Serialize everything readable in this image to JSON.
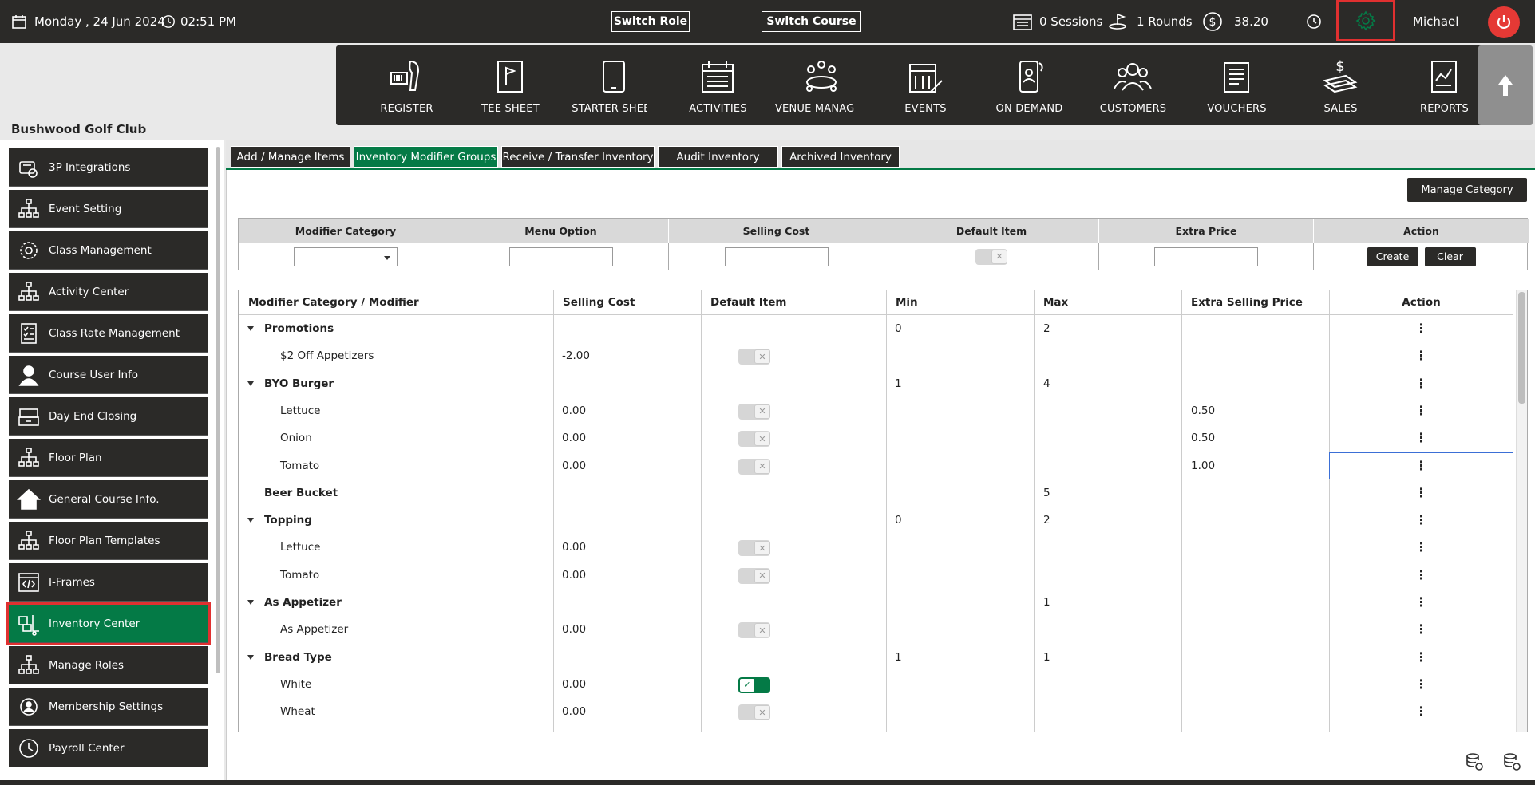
{
  "topbar": {
    "date": "Monday ,  24 Jun 2024",
    "time": "02:51 PM",
    "switch_role": "Switch Role",
    "switch_course": "Switch Course",
    "sessions": "0 Sessions",
    "rounds": "1 Rounds",
    "balance": "38.20",
    "user": "Michael",
    "gear_color": "#047a46",
    "power_color": "#e53935"
  },
  "modules": [
    {
      "label": "REGISTER",
      "icon": "barcode-scanner-icon"
    },
    {
      "label": "TEE SHEET",
      "icon": "golf-flag-icon"
    },
    {
      "label": "STARTER SHEET",
      "icon": "tablet-icon"
    },
    {
      "label": "ACTIVITIES",
      "icon": "calendar-list-icon"
    },
    {
      "label": "VENUE MANAGER",
      "icon": "meeting-table-icon"
    },
    {
      "label": "EVENTS",
      "icon": "calendar-edit-icon"
    },
    {
      "label": "ON DEMAND",
      "icon": "mobile-person-icon"
    },
    {
      "label": "CUSTOMERS",
      "icon": "people-group-icon"
    },
    {
      "label": "VOUCHERS",
      "icon": "voucher-icon"
    },
    {
      "label": "SALES",
      "icon": "sales-money-icon"
    },
    {
      "label": "REPORTS",
      "icon": "report-chart-icon"
    }
  ],
  "club_name": "Bushwood Golf Club",
  "sidebar": {
    "items": [
      {
        "label": "3P Integrations",
        "icon": "integrations-icon"
      },
      {
        "label": "Event Setting",
        "icon": "org-chart-icon"
      },
      {
        "label": "Class Management",
        "icon": "class-gear-icon"
      },
      {
        "label": "Activity  Center",
        "icon": "org-chart-icon"
      },
      {
        "label": "Class Rate Management",
        "icon": "checklist-icon"
      },
      {
        "label": "Course User Info",
        "icon": "user-icon"
      },
      {
        "label": "Day End Closing",
        "icon": "register-drawer-icon"
      },
      {
        "label": "Floor Plan",
        "icon": "org-chart-icon"
      },
      {
        "label": "General Course Info.",
        "icon": "home-icon"
      },
      {
        "label": "Floor Plan Templates",
        "icon": "org-chart-icon"
      },
      {
        "label": "I-Frames",
        "icon": "code-frame-icon"
      },
      {
        "label": "Inventory Center",
        "icon": "inventory-dolly-icon"
      },
      {
        "label": "Manage Roles",
        "icon": "org-chart-icon"
      },
      {
        "label": "Membership Settings",
        "icon": "gear-person-icon"
      },
      {
        "label": "Payroll Center",
        "icon": "clock-icon"
      }
    ],
    "active": "Inventory Center"
  },
  "tabs": [
    "Add / Manage Items",
    "Inventory Modifier Groups",
    "Receive / Transfer Inventory",
    "Audit Inventory",
    "Archived Inventory"
  ],
  "active_tab": "Inventory Modifier Groups",
  "manage_category": "Manage Category",
  "filter": {
    "headers": [
      "Modifier Category",
      "Menu Option",
      "Selling Cost",
      "Default Item",
      "Extra Price",
      "Action"
    ],
    "modifier_category_value": "",
    "menu_option_value": "",
    "selling_cost_value": "",
    "extra_price_value": "",
    "default_item_on": false,
    "create": "Create",
    "clear": "Clear"
  },
  "grid": {
    "headers": [
      "Modifier Category / Modifier",
      "Selling Cost",
      "Default Item",
      "Min",
      "Max",
      "Extra Selling Price",
      "Action"
    ],
    "rows": [
      {
        "name": "Promotions",
        "group": true,
        "cost": "",
        "toggle": null,
        "min": "0",
        "max": "2",
        "extra": ""
      },
      {
        "name": "$2 Off Appetizers",
        "group": false,
        "cost": "-2.00",
        "toggle": false,
        "min": "",
        "max": "",
        "extra": ""
      },
      {
        "name": "BYO Burger",
        "group": true,
        "cost": "",
        "toggle": null,
        "min": "1",
        "max": "4",
        "extra": ""
      },
      {
        "name": "Lettuce",
        "group": false,
        "cost": "0.00",
        "toggle": false,
        "min": "",
        "max": "",
        "extra": "0.50"
      },
      {
        "name": "Onion",
        "group": false,
        "cost": "0.00",
        "toggle": false,
        "min": "",
        "max": "",
        "extra": "0.50"
      },
      {
        "name": "Tomato",
        "group": false,
        "cost": "0.00",
        "toggle": false,
        "min": "",
        "max": "",
        "extra": "1.00",
        "selected": true
      },
      {
        "name": "Beer Bucket",
        "group": true,
        "nocaret": true,
        "cost": "",
        "toggle": null,
        "min": "",
        "max": "5",
        "extra": ""
      },
      {
        "name": "Topping",
        "group": true,
        "cost": "",
        "toggle": null,
        "min": "0",
        "max": "2",
        "extra": ""
      },
      {
        "name": "Lettuce",
        "group": false,
        "cost": "0.00",
        "toggle": false,
        "min": "",
        "max": "",
        "extra": ""
      },
      {
        "name": "Tomato",
        "group": false,
        "cost": "0.00",
        "toggle": false,
        "min": "",
        "max": "",
        "extra": ""
      },
      {
        "name": "As Appetizer",
        "group": true,
        "cost": "",
        "toggle": null,
        "min": "",
        "max": "1",
        "extra": ""
      },
      {
        "name": "As Appetizer",
        "group": false,
        "cost": "0.00",
        "toggle": false,
        "min": "",
        "max": "",
        "extra": ""
      },
      {
        "name": "Bread Type",
        "group": true,
        "cost": "",
        "toggle": null,
        "min": "1",
        "max": "1",
        "extra": ""
      },
      {
        "name": "White",
        "group": false,
        "cost": "0.00",
        "toggle": true,
        "min": "",
        "max": "",
        "extra": ""
      },
      {
        "name": "Wheat",
        "group": false,
        "cost": "0.00",
        "toggle": false,
        "min": "",
        "max": "",
        "extra": ""
      }
    ],
    "action_glyph": "⋮"
  },
  "colors": {
    "accent": "#047a46",
    "dark": "#2b2a28",
    "highlight": "#e03030"
  }
}
